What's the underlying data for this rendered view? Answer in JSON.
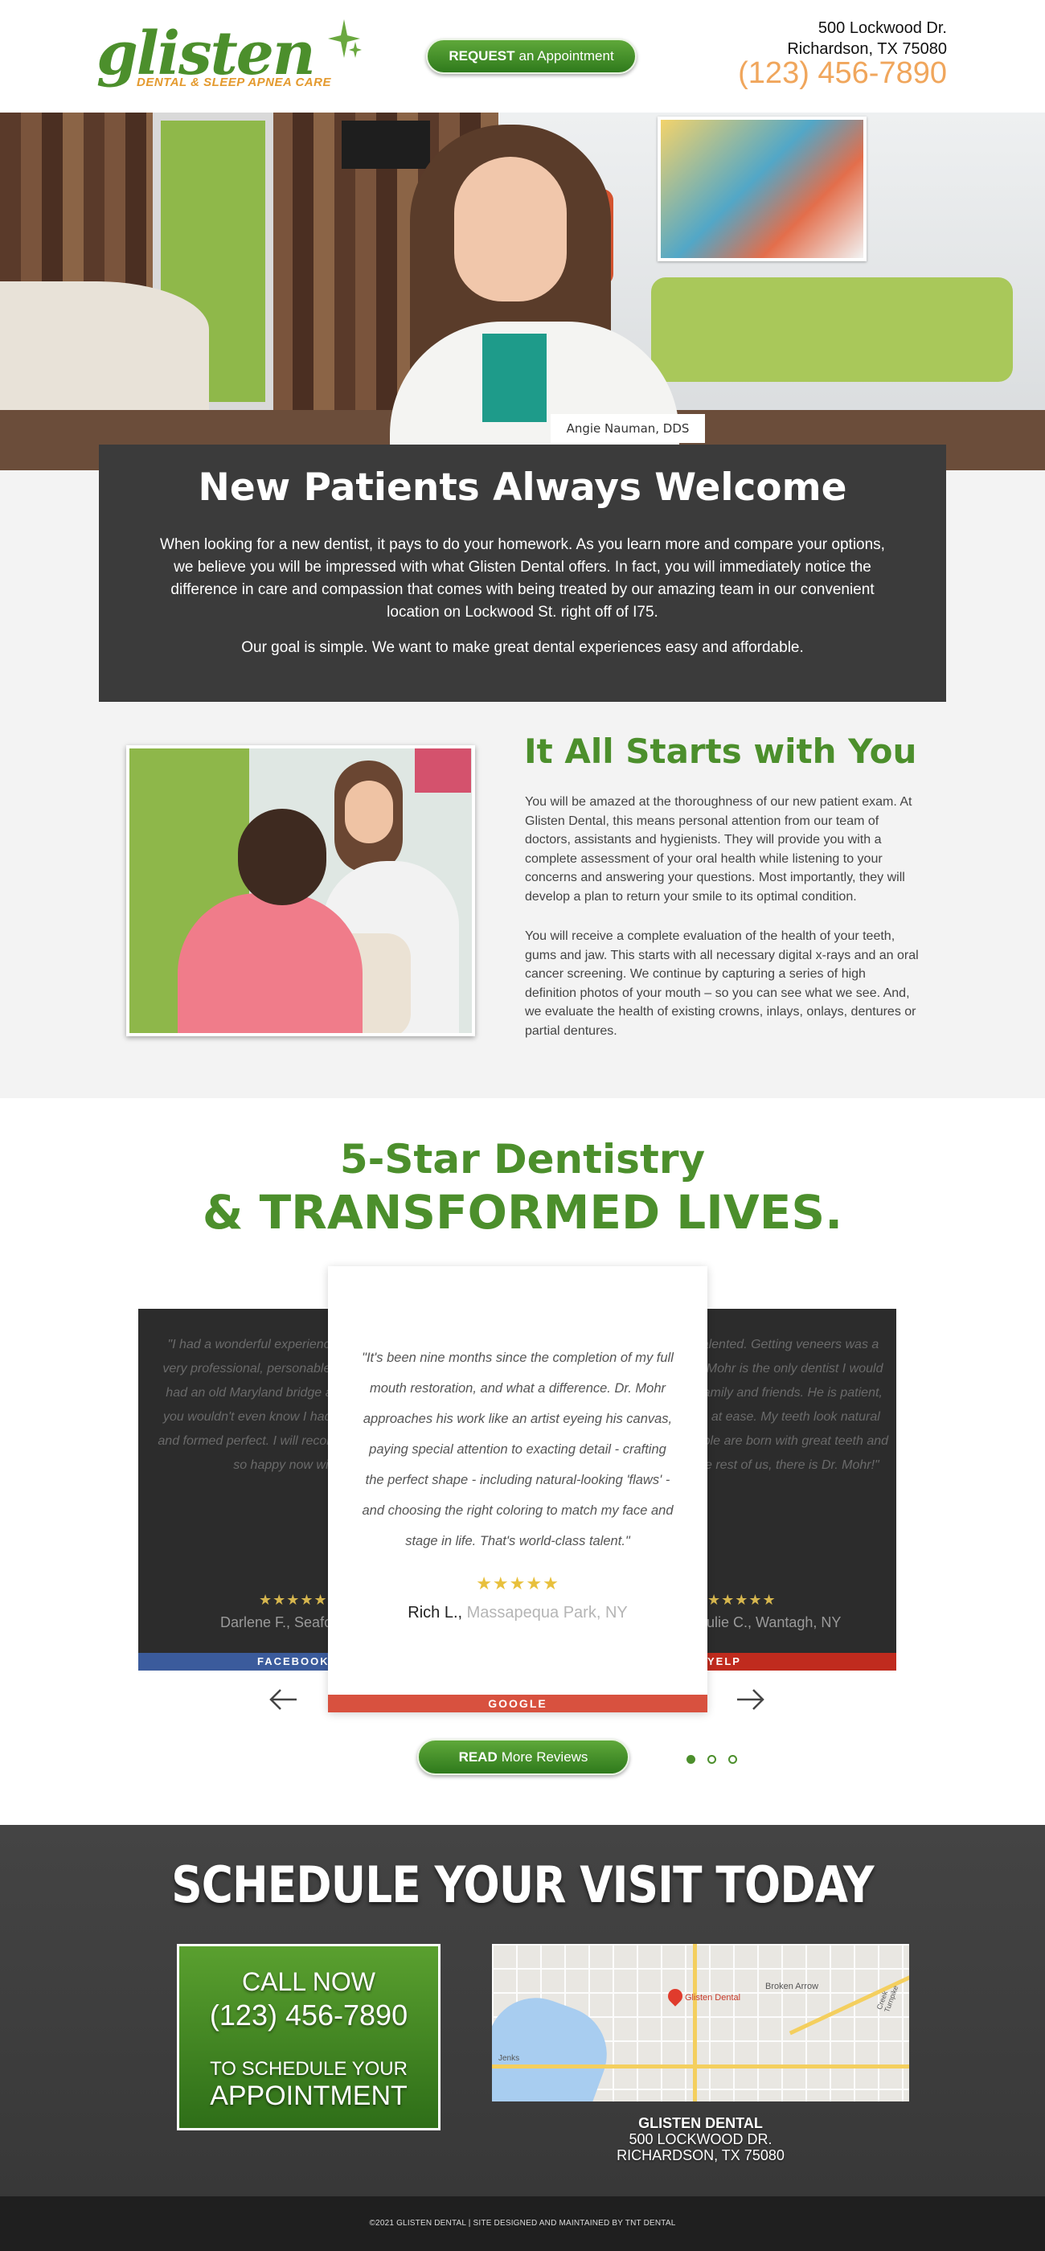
{
  "header": {
    "logo_word": "glisten",
    "logo_sub": "DENTAL & SLEEP APNEA CARE",
    "request_bold": "REQUEST",
    "request_rest": "an Appointment",
    "address_line1": "500 Lockwood Dr.",
    "address_line2": "Richardson, TX 75080",
    "phone": "(123) 456-7890"
  },
  "hero": {
    "doctor_caption": "Angie Nauman, DDS"
  },
  "welcome": {
    "title": "New Patients Always Welcome",
    "paragraph": "When looking for a new dentist, it pays to do your homework.  As you learn more and compare your options, we believe you will be impressed with what Glisten Dental offers.  In fact, you will immediately notice the difference in care and compassion that comes with being treated by our amazing team in our convenient location on Lockwood St. right off of I75.",
    "goal": "Our goal is simple.  We want to make great dental experiences easy and affordable."
  },
  "starts": {
    "title": "It All Starts with You",
    "p1": "You will be amazed at the thoroughness of our new patient exam. At Glisten Dental, this means personal attention from our team of doctors, assistants and hygienists.  They will provide you with a complete assessment of your oral health while listening to your concerns and answering your questions.  Most importantly, they will develop a plan to return your smile to its optimal condition.",
    "p2": "You will receive a complete evaluation of the health of your teeth, gums and jaw.  This starts with all necessary digital x-rays and an oral cancer screening.  We continue by capturing a series of high definition photos of your mouth – so you can see what we see.  And, we evaluate the health of existing crowns, inlays, onlays, dentures or partial dentures."
  },
  "reviews": {
    "heading1": "5-Star Dentistry",
    "heading2": "& TRANSFORMED LIVES.",
    "left": {
      "text": "\"I had a wonderful experience in this office. The staff is very professional, personable and Dr Mohr is excellent. I had an old Maryland bridge and he did such a great job you wouldn't even know I had work done, teeth matched and formed perfect. I will recommend him to everyone! I'm so happy now with confidence.\"",
      "stars": "★★★★★",
      "name": "Darlene F., Seaford, NY",
      "source": "FACEBOOK"
    },
    "center": {
      "text": "\"It's been nine months since the completion of my full mouth restoration, and what a difference. Dr. Mohr approaches his work like an artist eyeing his canvas, paying special attention to exacting detail - crafting the perfect shape - including natural-looking 'flaws' - and choosing the right coloring to match my face and stage in life. That's world-class talent.\"",
      "stars": "★★★★★",
      "name": "Rich L.,",
      "location": "Massapequa Park, NY",
      "source": "GOOGLE"
    },
    "right": {
      "text": "\"Dr. Mohr is extremely talented. Getting veneers was a personal choice, and Dr. Mohr is the only dentist I would ever recommend to my family and friends. He is patient, kind and always puts me at ease. My teeth look natural and feel great. Some people are born with great teeth and perfect smiles, but for the rest of us, there is Dr. Mohr!\"",
      "stars": "★★★★★",
      "name": "Julie C., Wantagh, NY",
      "source": "YELP"
    },
    "more_bold": "READ",
    "more_rest": "More Reviews"
  },
  "schedule": {
    "heading": "SCHEDULE YOUR VISIT TODAY",
    "call_now": "CALL NOW",
    "phone": "(123) 456-7890",
    "to_schedule": "TO SCHEDULE YOUR",
    "appointment": "APPOINTMENT",
    "map_pin_label": "Glisten Dental",
    "map_area1": "Broken Arrow",
    "map_area2": "Jenks",
    "map_area3": "Creek Turnpike",
    "address_name": "GLISTEN DENTAL",
    "address_line1": "500 LOCKWOOD DR.",
    "address_line2": "RICHARDSON, TX 75080"
  },
  "footer": {
    "text": "©2021 GLISTEN DENTAL | SITE DESIGNED AND MAINTAINED BY TNT DENTAL"
  },
  "colors": {
    "brand_green": "#4c8f2c",
    "accent_orange": "#f0a65c",
    "dark_panel": "#3b3b3b"
  }
}
